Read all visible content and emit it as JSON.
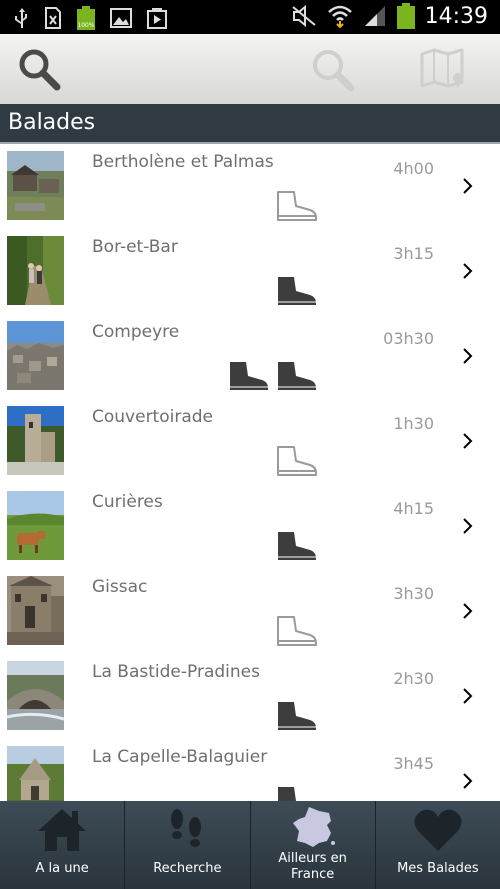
{
  "status_bar": {
    "time": "14:39",
    "battery_label": "100%"
  },
  "toolbar": {},
  "section": {
    "title": "Balades"
  },
  "items": [
    {
      "name": "Bertholène et Palmas",
      "duration": "4h00",
      "boots": "outline1"
    },
    {
      "name": "Bor-et-Bar",
      "duration": "3h15",
      "boots": "filled1"
    },
    {
      "name": "Compeyre",
      "duration": "03h30",
      "boots": "filled2"
    },
    {
      "name": "Couvertoirade",
      "duration": "1h30",
      "boots": "outline1"
    },
    {
      "name": "Curières",
      "duration": "4h15",
      "boots": "filled1"
    },
    {
      "name": "Gissac",
      "duration": "3h30",
      "boots": "outline1"
    },
    {
      "name": "La Bastide-Pradines",
      "duration": "2h30",
      "boots": "filled1"
    },
    {
      "name": "La Capelle-Balaguier",
      "duration": "3h45",
      "boots": "filled1"
    }
  ],
  "tabs": [
    {
      "label": "A la une"
    },
    {
      "label": "Recherche"
    },
    {
      "label_line1": "Ailleurs en",
      "label_line2": "France"
    },
    {
      "label": "Mes Balades"
    }
  ]
}
